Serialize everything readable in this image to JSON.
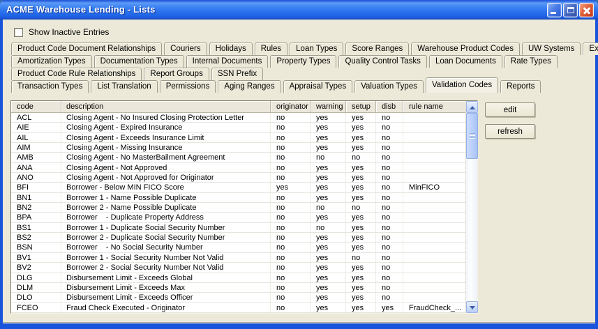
{
  "window": {
    "title": "ACME Warehouse Lending - Lists",
    "controls": [
      "minimize",
      "maximize",
      "close"
    ]
  },
  "colors": {
    "titlebar_blue": "#2F74EE",
    "window_border_blue": "#1A54DB",
    "client_beige": "#ECE9D8",
    "close_button_red": "#D8502C",
    "scrollbar_blue": "#BBD0FA"
  },
  "checkbox": {
    "label": "Show Inactive Entries",
    "checked": false
  },
  "tabs": {
    "selected": "Validation Codes",
    "rows": [
      [
        "Product Code Document Relationships",
        "Couriers",
        "Holidays",
        "Rules",
        "Loan Types",
        "Score Ranges",
        "Warehouse Product Codes",
        "UW Systems",
        "Exception Codes"
      ],
      [
        "Amortization Types",
        "Documentation Types",
        "Internal Documents",
        "Property Types",
        "Quality Control Tasks",
        "Loan Documents",
        "Rate Types"
      ],
      [
        "Product Code Rule Relationships",
        "Report Groups",
        "SSN Prefix"
      ],
      [
        "Transaction Types",
        "List Translation",
        "Permissions",
        "Aging Ranges",
        "Appraisal Types",
        "Valuation Types",
        "Validation Codes",
        "Reports"
      ]
    ]
  },
  "table": {
    "columns": [
      "code",
      "description",
      "originator",
      "warning",
      "setup",
      "disb",
      "rule name"
    ],
    "rows": [
      {
        "code": "ACL",
        "description": "Closing Agent - No Insured Closing Protection Letter",
        "originator": "no",
        "warning": "yes",
        "setup": "yes",
        "disb": "no",
        "rule_name": ""
      },
      {
        "code": "AIE",
        "description": "Closing Agent - Expired Insurance",
        "originator": "no",
        "warning": "yes",
        "setup": "yes",
        "disb": "no",
        "rule_name": ""
      },
      {
        "code": "AIL",
        "description": "Closing Agent - Exceeds Insurance Limit",
        "originator": "no",
        "warning": "yes",
        "setup": "yes",
        "disb": "no",
        "rule_name": ""
      },
      {
        "code": "AIM",
        "description": "Closing Agent - Missing Insurance",
        "originator": "no",
        "warning": "yes",
        "setup": "yes",
        "disb": "no",
        "rule_name": ""
      },
      {
        "code": "AMB",
        "description": "Closing Agent - No MasterBailment Agreement",
        "originator": "no",
        "warning": "no",
        "setup": "no",
        "disb": "no",
        "rule_name": ""
      },
      {
        "code": "ANA",
        "description": "Closing Agent - Not Approved",
        "originator": "no",
        "warning": "yes",
        "setup": "yes",
        "disb": "no",
        "rule_name": ""
      },
      {
        "code": "ANO",
        "description": "Closing Agent - Not Approved for Originator",
        "originator": "no",
        "warning": "yes",
        "setup": "yes",
        "disb": "no",
        "rule_name": ""
      },
      {
        "code": "BFI",
        "description": "Borrower - Below MIN FICO Score",
        "originator": "yes",
        "warning": "yes",
        "setup": "yes",
        "disb": "no",
        "rule_name": "MinFICO"
      },
      {
        "code": "BN1",
        "description": "Borrower 1 - Name Possible Duplicate",
        "originator": "no",
        "warning": "yes",
        "setup": "yes",
        "disb": "no",
        "rule_name": ""
      },
      {
        "code": "BN2",
        "description": "Borrower 2 - Name Possible Duplicate",
        "originator": "no",
        "warning": "no",
        "setup": "no",
        "disb": "no",
        "rule_name": ""
      },
      {
        "code": "BPA",
        "description": "Borrower    - Duplicate Property Address",
        "originator": "no",
        "warning": "yes",
        "setup": "yes",
        "disb": "no",
        "rule_name": ""
      },
      {
        "code": "BS1",
        "description": "Borrower 1 - Duplicate Social Security Number",
        "originator": "no",
        "warning": "no",
        "setup": "yes",
        "disb": "no",
        "rule_name": ""
      },
      {
        "code": "BS2",
        "description": "Borrower 2 - Duplicate Social Security Number",
        "originator": "no",
        "warning": "yes",
        "setup": "yes",
        "disb": "no",
        "rule_name": ""
      },
      {
        "code": "BSN",
        "description": "Borrower    - No Social Security Number",
        "originator": "no",
        "warning": "yes",
        "setup": "yes",
        "disb": "no",
        "rule_name": ""
      },
      {
        "code": "BV1",
        "description": "Borrower 1 - Social Security Number Not Valid",
        "originator": "no",
        "warning": "yes",
        "setup": "no",
        "disb": "no",
        "rule_name": ""
      },
      {
        "code": "BV2",
        "description": "Borrower 2 - Social Security Number Not Valid",
        "originator": "no",
        "warning": "yes",
        "setup": "yes",
        "disb": "no",
        "rule_name": ""
      },
      {
        "code": "DLG",
        "description": "Disbursement Limit - Exceeds Global",
        "originator": "no",
        "warning": "yes",
        "setup": "yes",
        "disb": "no",
        "rule_name": ""
      },
      {
        "code": "DLM",
        "description": "Disbursement Limit - Exceeds Max",
        "originator": "no",
        "warning": "yes",
        "setup": "yes",
        "disb": "no",
        "rule_name": ""
      },
      {
        "code": "DLO",
        "description": "Disbursement Limit - Exceeds Officer",
        "originator": "no",
        "warning": "yes",
        "setup": "yes",
        "disb": "no",
        "rule_name": ""
      },
      {
        "code": "FCEO",
        "description": "Fraud Check Executed - Originator",
        "originator": "no",
        "warning": "yes",
        "setup": "yes",
        "disb": "yes",
        "rule_name": "FraudCheck_..."
      }
    ]
  },
  "buttons": {
    "edit": "edit",
    "refresh": "refresh"
  }
}
